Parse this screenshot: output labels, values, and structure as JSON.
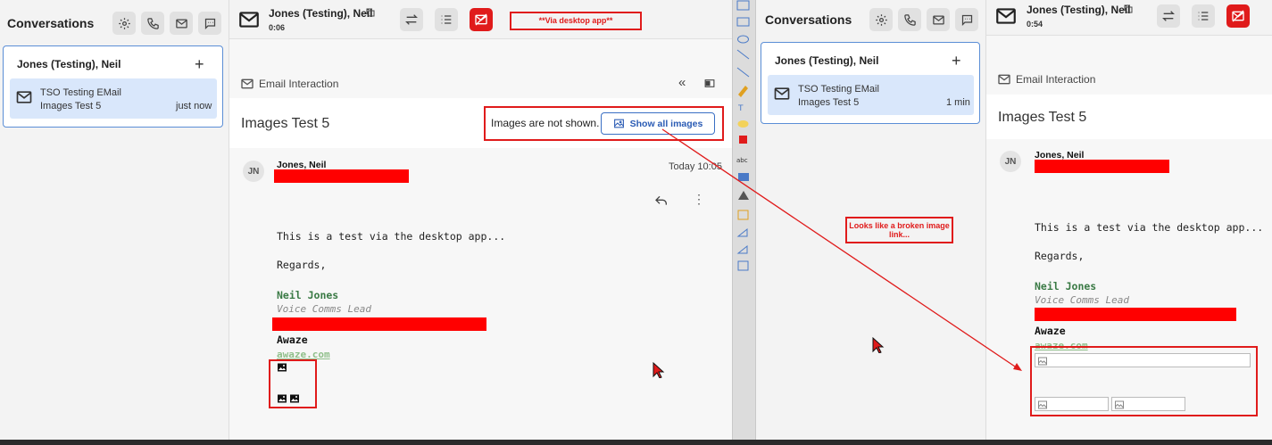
{
  "left": {
    "sidebar": {
      "title": "Conversations",
      "conversation_name": "Jones (Testing), Neil",
      "item_line1": "TSO Testing EMail",
      "item_line2": "Images Test 5",
      "item_time": "just now"
    },
    "header": {
      "name": "Jones (Testing), Neil",
      "timer": "0:06"
    },
    "annotation": "**Via desktop app**",
    "interaction_label": "Email Interaction",
    "subject": "Images Test 5",
    "images_notice": "Images are not shown.",
    "show_images_label": "Show all images",
    "message": {
      "avatar": "JN",
      "sender": "Jones, Neil",
      "date": "Today 10:05",
      "body_line1": "This is a test via the desktop app...",
      "body_line2": "Regards,",
      "sig_name": "Neil Jones",
      "sig_title": "Voice Comms Lead",
      "sig_company": "Awaze",
      "sig_link": "awaze.com"
    }
  },
  "right": {
    "sidebar": {
      "title": "Conversations",
      "conversation_name": "Jones (Testing), Neil",
      "item_line1": "TSO Testing EMail",
      "item_line2": "Images Test 5",
      "item_time": "1 min"
    },
    "header": {
      "name": "Jones (Testing), Neil",
      "timer": "0:54"
    },
    "annotation": "Looks like a broken image link...",
    "interaction_label": "Email Interaction",
    "subject": "Images Test 5",
    "message": {
      "avatar": "JN",
      "sender": "Jones, Neil",
      "body_line1": "This is a test via the desktop app...",
      "body_line2": "Regards,",
      "sig_name": "Neil Jones",
      "sig_title": "Voice Comms Lead",
      "sig_company": "Awaze",
      "sig_link": "awaze.com"
    }
  },
  "colors": {
    "accent": "#3a6fc4",
    "annotation_red": "#e01b1b",
    "selected_item": "#d9e7fb",
    "signature_green": "#3a7a45"
  },
  "icons": [
    "gear-icon",
    "phone-icon",
    "mail-icon",
    "chat-icon",
    "envelope-icon",
    "copy-icon",
    "transfer-icon",
    "list-icon",
    "end-email-icon",
    "collapse-icon",
    "panel-icon",
    "reply-icon",
    "more-icon",
    "image-icon",
    "broken-image-icon",
    "cursor-icon"
  ]
}
